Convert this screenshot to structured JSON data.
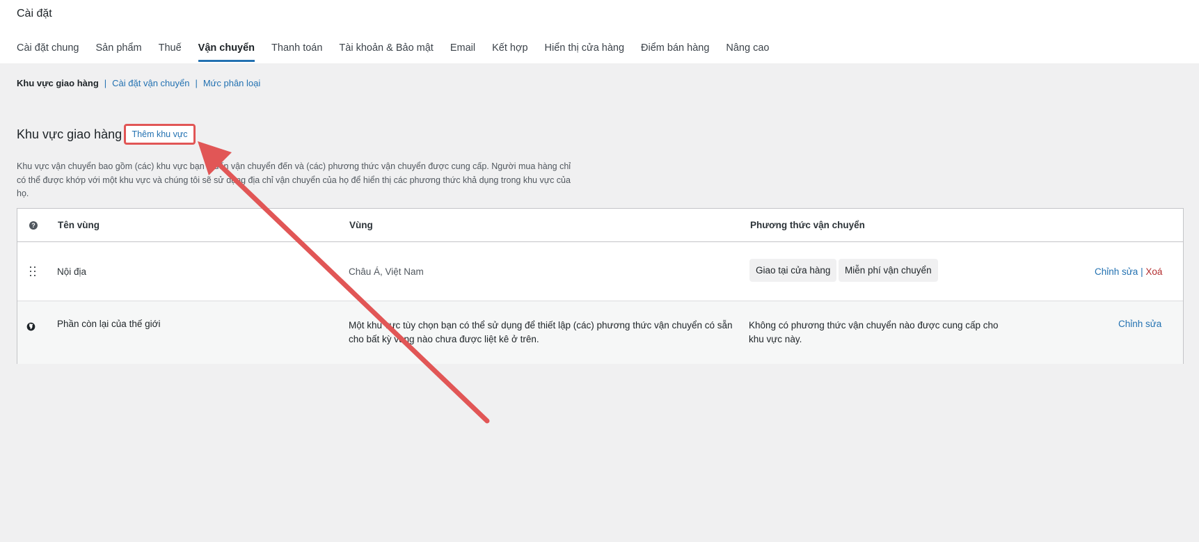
{
  "page_title": "Cài đặt",
  "tabs": [
    {
      "label": "Cài đặt chung"
    },
    {
      "label": "Sản phẩm"
    },
    {
      "label": "Thuế"
    },
    {
      "label": "Vận chuyển"
    },
    {
      "label": "Thanh toán"
    },
    {
      "label": "Tài khoản & Bảo mật"
    },
    {
      "label": "Email"
    },
    {
      "label": "Kết hợp"
    },
    {
      "label": "Hiển thị cửa hàng"
    },
    {
      "label": "Điểm bán hàng"
    },
    {
      "label": "Nâng cao"
    }
  ],
  "active_tab": "Vận chuyển",
  "subnav": {
    "current": "Khu vực giao hàng",
    "separator": "|",
    "links": [
      "Cài đặt vận chuyển",
      "Mức phân loại"
    ]
  },
  "section": {
    "title": "Khu vực giao hàng",
    "add_button": "Thêm khu vực",
    "description": "Khu vực vận chuyển bao gồm (các) khu vực bạn muốn vận chuyển đến và (các) phương thức vận chuyển được cung cấp. Người mua hàng chỉ có thể được khớp với một khu vực và chúng tôi sẽ sử dụng địa chỉ vận chuyển của họ để hiển thị các phương thức khả dụng trong khu vực của họ."
  },
  "table": {
    "headers": {
      "help_icon": "help-icon",
      "zone_name": "Tên vùng",
      "region": "Vùng",
      "methods": "Phương thức vận chuyển"
    },
    "rows": [
      {
        "name": "Nội địa",
        "region": "Châu Á, Việt Nam",
        "methods": [
          "Giao tại cửa hàng",
          "Miễn phí vận chuyển"
        ],
        "edit": "Chỉnh sửa",
        "separator": "|",
        "delete": "Xoá"
      },
      {
        "name": "Phần còn lại của thế giới",
        "region": "Một khu vực tùy chọn bạn có thể sử dụng để thiết lập (các) phương thức vận chuyển có sẵn cho bất kỳ vùng nào chưa được liệt kê ở trên.",
        "methods_text": "Không có phương thức vận chuyển nào được cung cấp cho khu vực này.",
        "edit": "Chỉnh sửa"
      }
    ]
  },
  "colors": {
    "accent": "#2271b1",
    "highlight": "#e15656",
    "delete": "#b32d2e"
  }
}
